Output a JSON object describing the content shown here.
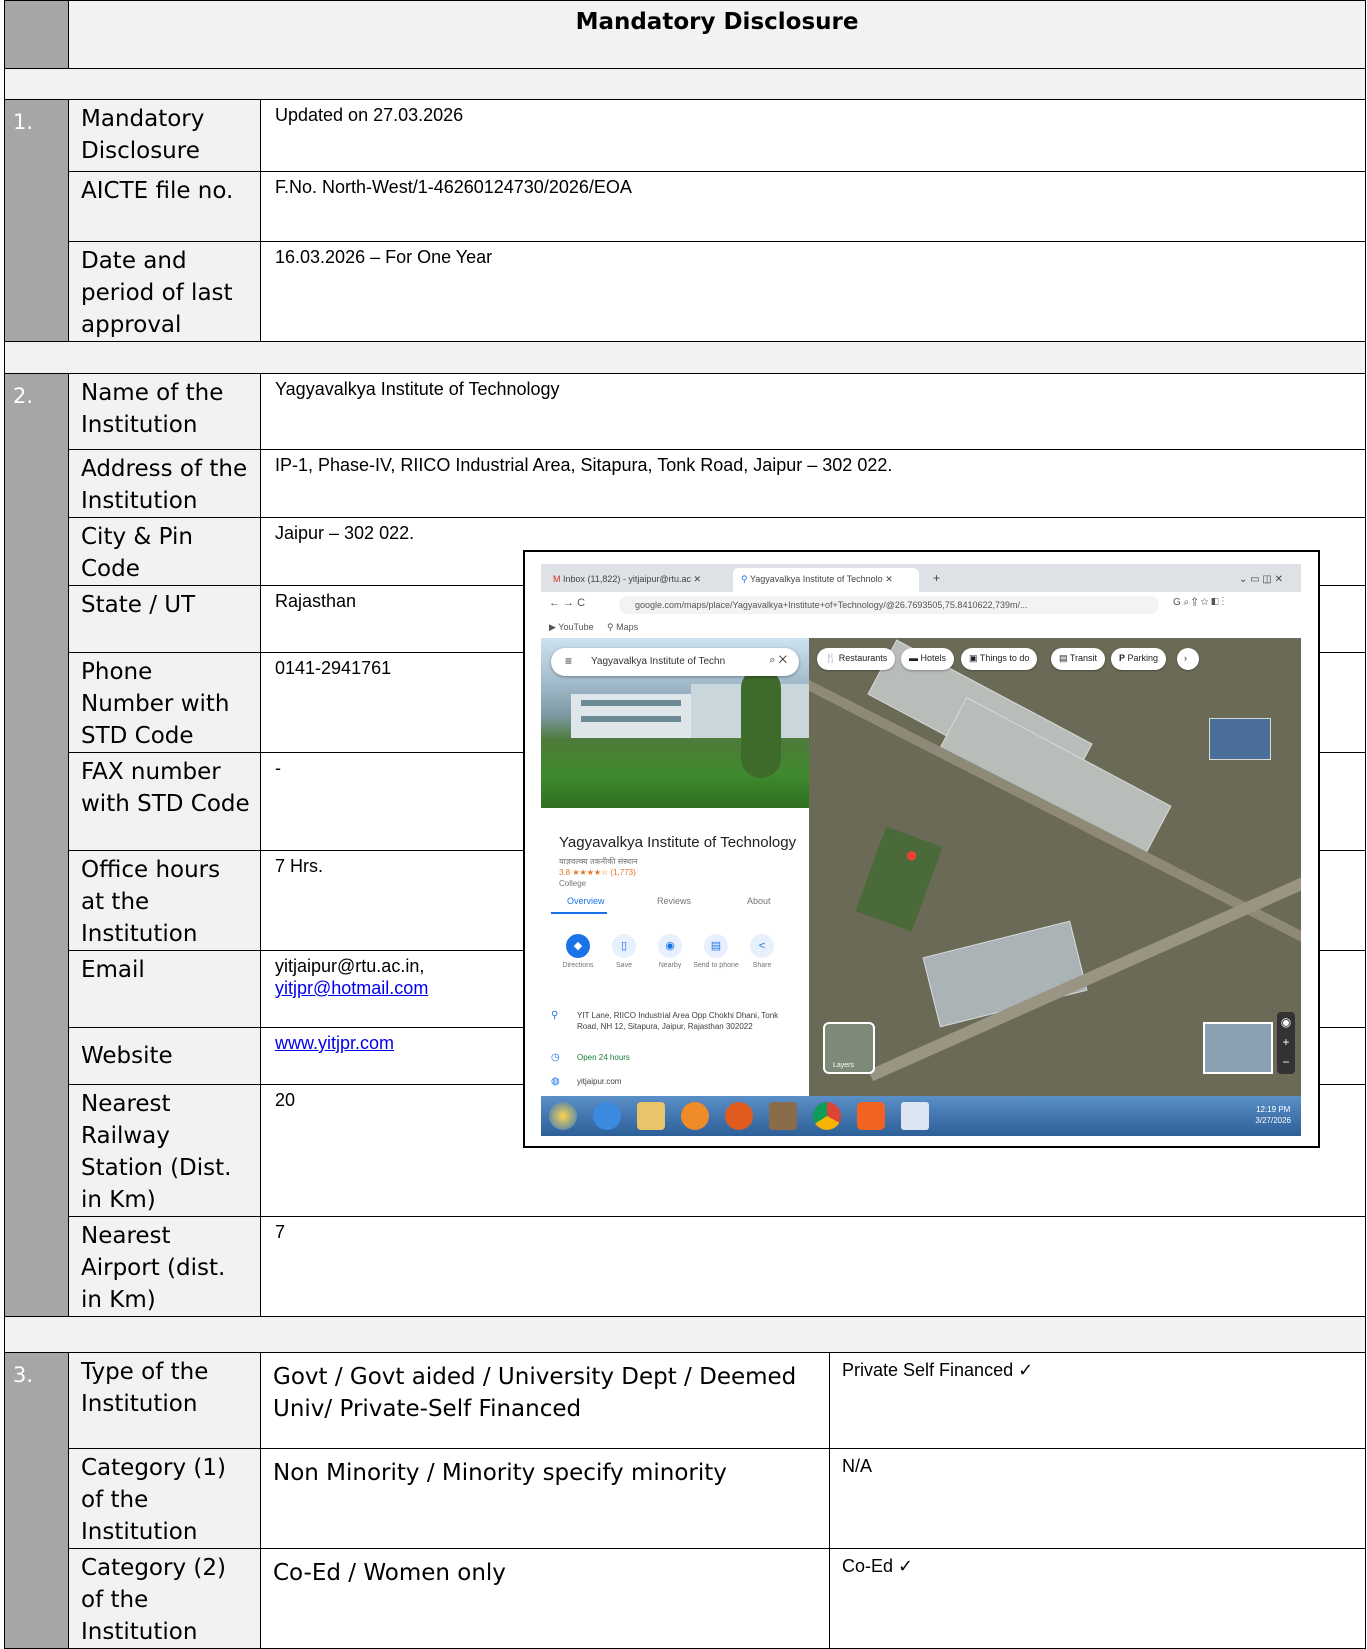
{
  "header": {
    "title": "Mandatory Disclosure"
  },
  "sections": {
    "s1": {
      "num": "1.",
      "rows": [
        {
          "label": "Mandatory Disclosure",
          "value": "Updated on 27.03.2026"
        },
        {
          "label": "AICTE file no.",
          "value": "F.No. North-West/1-46260124730/2026/EOA"
        },
        {
          "label": "Date and period of last approval",
          "value": "16.03.2026 – For One Year"
        }
      ]
    },
    "s2": {
      "num": "2.",
      "rows": [
        {
          "label": "Name of the Institution",
          "value": "Yagyavalkya Institute of Technology"
        },
        {
          "label": "Address of the Institution",
          "value": "IP-1, Phase-IV, RIICO Industrial Area, Sitapura, Tonk Road, Jaipur – 302 022."
        },
        {
          "label": "City  & Pin Code",
          "value": "Jaipur – 302 022."
        },
        {
          "label": "State / UT",
          "value": "Rajasthan"
        },
        {
          "label": "Phone Number with STD Code",
          "value": "0141-2941761"
        },
        {
          "label": "FAX number with STD Code",
          "value": "-"
        },
        {
          "label": "Office hours at the Institution",
          "value": "7 Hrs."
        },
        {
          "label": "Email",
          "value": "yitjaipur@rtu.ac.in,",
          "link": "yitjpr@hotmail.com"
        },
        {
          "label": "Website",
          "link": "www.yitjpr.com"
        },
        {
          "label": "Nearest Railway Station (Dist. in Km)",
          "value": "20"
        },
        {
          "label": "Nearest Airport (dist. in Km)",
          "value": "7"
        }
      ]
    },
    "s3": {
      "num": "3.",
      "rows": [
        {
          "label": "Type of the Institution",
          "options": "Govt / Govt aided / University Dept / Deemed Univ/ Private-Self Financed",
          "selected": "Private Self Financed ✓"
        },
        {
          "label": "Category (1) of the Institution",
          "options": "Non Minority / Minority specify minority",
          "selected": "N/A"
        },
        {
          "label": "Category (2) of the Institution",
          "options": "Co-Ed / Women only",
          "selected": "Co-Ed ✓"
        }
      ]
    }
  },
  "screenshot": {
    "tabs": [
      "Inbox (11,822) - yitjaipur@rtu.ac",
      "Yagyavalkya Institute of Technolo"
    ],
    "url": "google.com/maps/place/Yagyavalkya+Institute+of+Technology/@26.7693505,75.8410622,739m/...",
    "bookmarks": [
      "YouTube",
      "Maps"
    ],
    "search": "Yagyavalkya Institute of Techn",
    "place_name": "Yagyavalkya Institute of Technology",
    "place_hindi": "याज्ञवल्क्य तकनीकी संस्थान",
    "rating": "3.8 ★★★★☆ (1,773)",
    "category": "College",
    "tabs_place": [
      "Overview",
      "Reviews",
      "About"
    ],
    "actions": [
      "Directions",
      "Save",
      "Nearby",
      "Send to phone",
      "Share"
    ],
    "address": "YIT Lane, RIICO Industrial Area Opp Chokhi Dhani, Tonk Road, NH 12, Sitapura, Jaipur, Rajasthan 302022",
    "hours": "Open 24 hours",
    "site": "yitjaipur.com",
    "chips": [
      "Restaurants",
      "Hotels",
      "Things to do",
      "Transit",
      "Parking"
    ],
    "layers": "Layers",
    "clock": "12:19 PM",
    "date": "3/27/2026"
  },
  "colors": {
    "number_col": "#a6a6a6",
    "label_bg": "#f2f2f2",
    "link": "#0000ee"
  }
}
